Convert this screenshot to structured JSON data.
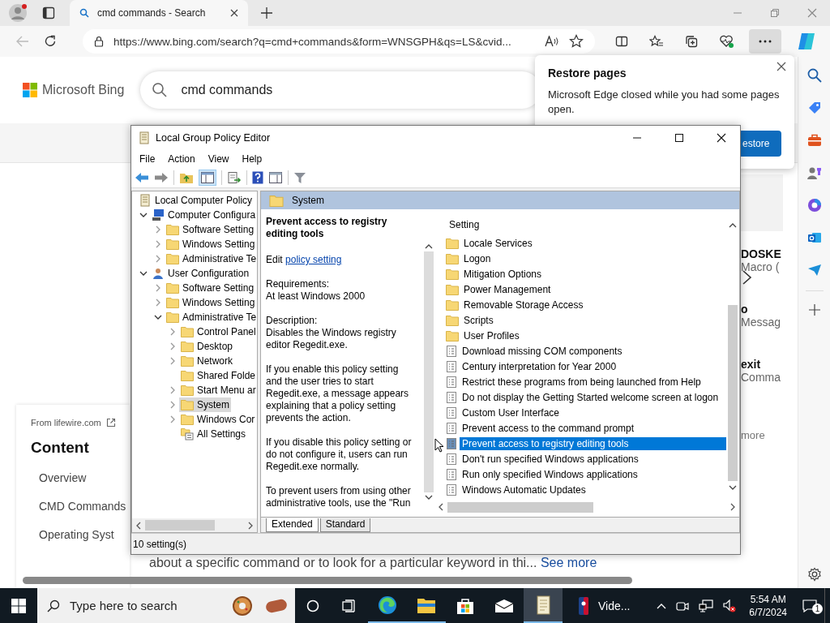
{
  "browser": {
    "tab_title": "cmd commands - Search",
    "address": "https://www.bing.com/search?q=cmd+commands&form=WNSGPH&qs=LS&cvid..."
  },
  "restore_popup": {
    "title": "Restore pages",
    "message": "Microsoft Edge closed while you had some pages open.",
    "button": "estore"
  },
  "bing": {
    "logo": "Microsoft Bing",
    "query": "cmd commands",
    "source": "From lifewire.com",
    "toc_title": "Content",
    "toc": [
      "Overview",
      "CMD Commands",
      "Operating Syst"
    ],
    "snippet": "about a specific command or to look for a particular keyword in thi...",
    "see_more": "See more",
    "cards": [
      {
        "title": "DOSKE",
        "text": "Macro ("
      },
      {
        "title": "o",
        "text": "Messag"
      },
      {
        "title": "exit",
        "text": "Comma"
      }
    ],
    "more": "more"
  },
  "gpedit": {
    "title": "Local Group Policy Editor",
    "menu": [
      "File",
      "Action",
      "View",
      "Help"
    ],
    "tree": [
      {
        "label": "Local Computer Policy",
        "kind": "policy",
        "selected": false,
        "children": [
          {
            "label": "Computer Configura",
            "kind": "computer",
            "expanded": true,
            "selected": false,
            "children": [
              {
                "label": "Software Setting",
                "kind": "folder",
                "expanded": false,
                "selected": false
              },
              {
                "label": "Windows Setting",
                "kind": "folder",
                "expanded": false,
                "selected": false
              },
              {
                "label": "Administrative Te",
                "kind": "folder",
                "expanded": false,
                "selected": false
              }
            ]
          },
          {
            "label": "User Configuration",
            "kind": "user",
            "expanded": true,
            "selected": false,
            "children": [
              {
                "label": "Software Setting",
                "kind": "folder",
                "expanded": false,
                "selected": false
              },
              {
                "label": "Windows Setting",
                "kind": "folder",
                "expanded": false,
                "selected": false
              },
              {
                "label": "Administrative Te",
                "kind": "folder",
                "expanded": true,
                "selected": false,
                "children": [
                  {
                    "label": "Control Panel",
                    "kind": "folder",
                    "expanded": false,
                    "selected": false
                  },
                  {
                    "label": "Desktop",
                    "kind": "folder",
                    "expanded": false,
                    "selected": false
                  },
                  {
                    "label": "Network",
                    "kind": "folder",
                    "expanded": false,
                    "selected": false
                  },
                  {
                    "label": "Shared Folde",
                    "kind": "folder",
                    "selected": false
                  },
                  {
                    "label": "Start Menu ar",
                    "kind": "folder",
                    "expanded": false,
                    "selected": false
                  },
                  {
                    "label": "System",
                    "kind": "folder",
                    "expanded": false,
                    "selected": true
                  },
                  {
                    "label": "Windows Cor",
                    "kind": "folder",
                    "expanded": false,
                    "selected": false
                  },
                  {
                    "label": "All Settings",
                    "kind": "settings",
                    "selected": false
                  }
                ]
              }
            ]
          }
        ]
      }
    ],
    "header": "System",
    "description": {
      "heading": "Prevent access to registry editing tools",
      "edit": "Edit",
      "link": "policy setting",
      "requirements_label": "Requirements:",
      "requirements": "At least Windows 2000",
      "description_label": "Description:",
      "paragraphs": [
        "Disables the Windows registry editor Regedit.exe.",
        "If you enable this policy setting and the user tries to start Regedit.exe, a message appears explaining that a policy setting prevents the action.",
        "If you disable this policy setting or do not configure it, users can run Regedit.exe normally.",
        "To prevent users from using other administrative tools, use the \"Run"
      ]
    },
    "column": "Setting",
    "settings": [
      {
        "label": "Locale Services",
        "kind": "folder",
        "selected": false
      },
      {
        "label": "Logon",
        "kind": "folder",
        "selected": false
      },
      {
        "label": "Mitigation Options",
        "kind": "folder",
        "selected": false
      },
      {
        "label": "Power Management",
        "kind": "folder",
        "selected": false
      },
      {
        "label": "Removable Storage Access",
        "kind": "folder",
        "selected": false
      },
      {
        "label": "Scripts",
        "kind": "folder",
        "selected": false
      },
      {
        "label": "User Profiles",
        "kind": "folder",
        "selected": false
      },
      {
        "label": "Download missing COM components",
        "kind": "policy",
        "selected": false
      },
      {
        "label": "Century interpretation for Year 2000",
        "kind": "policy",
        "selected": false
      },
      {
        "label": "Restrict these programs from being launched from Help",
        "kind": "policy",
        "selected": false
      },
      {
        "label": "Do not display the Getting Started welcome screen at logon",
        "kind": "policy",
        "selected": false
      },
      {
        "label": "Custom User Interface",
        "kind": "policy",
        "selected": false
      },
      {
        "label": "Prevent access to the command prompt",
        "kind": "policy",
        "selected": false
      },
      {
        "label": "Prevent access to registry editing tools",
        "kind": "policy",
        "selected": true
      },
      {
        "label": "Don't run specified Windows applications",
        "kind": "policy",
        "selected": false
      },
      {
        "label": "Run only specified Windows applications",
        "kind": "policy",
        "selected": false
      },
      {
        "label": "Windows Automatic Updates",
        "kind": "policy",
        "selected": false
      }
    ],
    "tabs": [
      {
        "label": "Extended",
        "selected": true
      },
      {
        "label": "Standard",
        "selected": false
      }
    ],
    "status": "10 setting(s)"
  },
  "taskbar": {
    "search_placeholder": "Type here to search",
    "apps": [
      {
        "kind": "edge",
        "running": true,
        "active": false
      },
      {
        "kind": "explorer",
        "running": true,
        "active": false
      },
      {
        "kind": "store",
        "running": false,
        "active": false
      },
      {
        "kind": "mail",
        "running": false,
        "active": false
      },
      {
        "kind": "editor",
        "running": true,
        "active": true
      }
    ],
    "media_label": "Vide...",
    "time": "5:54 AM",
    "date": "6/7/2024",
    "notifications": "1"
  }
}
